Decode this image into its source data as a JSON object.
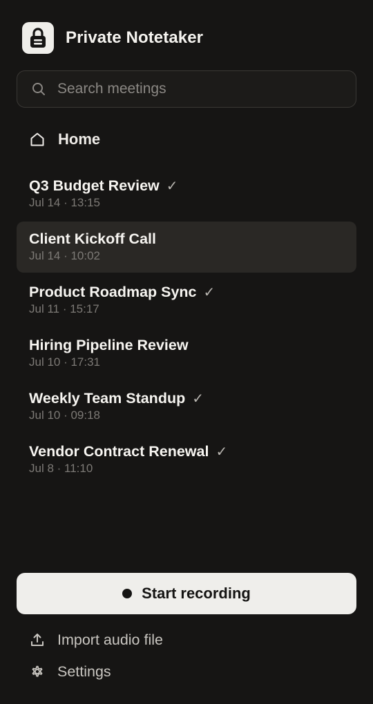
{
  "app": {
    "title": "Private Notetaker",
    "logo_icon": "lock-icon"
  },
  "search": {
    "placeholder": "Search meetings",
    "value": "",
    "icon": "search-icon"
  },
  "nav": {
    "home_label": "Home",
    "home_icon": "home-icon"
  },
  "meetings": [
    {
      "title": "Q3 Budget Review",
      "date": "Jul 14 · 13:15",
      "check": "✓",
      "completed": true,
      "selected": false
    },
    {
      "title": "Client Kickoff Call",
      "date": "Jul 14 · 10:02",
      "check": "",
      "completed": false,
      "selected": true
    },
    {
      "title": "Product Roadmap Sync",
      "date": "Jul 11 · 15:17",
      "check": "✓",
      "completed": true,
      "selected": false
    },
    {
      "title": "Hiring Pipeline Review",
      "date": "Jul 10 · 17:31",
      "check": "",
      "completed": false,
      "selected": false
    },
    {
      "title": "Weekly Team Standup",
      "date": "Jul 10 · 09:18",
      "check": "✓",
      "completed": true,
      "selected": false
    },
    {
      "title": "Vendor Contract Renewal",
      "date": "Jul 8 · 11:10",
      "check": "✓",
      "completed": true,
      "selected": false
    }
  ],
  "actions": {
    "start_recording_label": "Start recording",
    "import_label": "Import audio file",
    "import_icon": "upload-icon",
    "settings_label": "Settings",
    "settings_icon": "gear-icon"
  },
  "colors": {
    "background": "#161514",
    "selected_row": "#2a2825",
    "primary_button": "#efeeeb",
    "text_primary": "#f7f5f1",
    "text_muted": "#7d7a76"
  }
}
